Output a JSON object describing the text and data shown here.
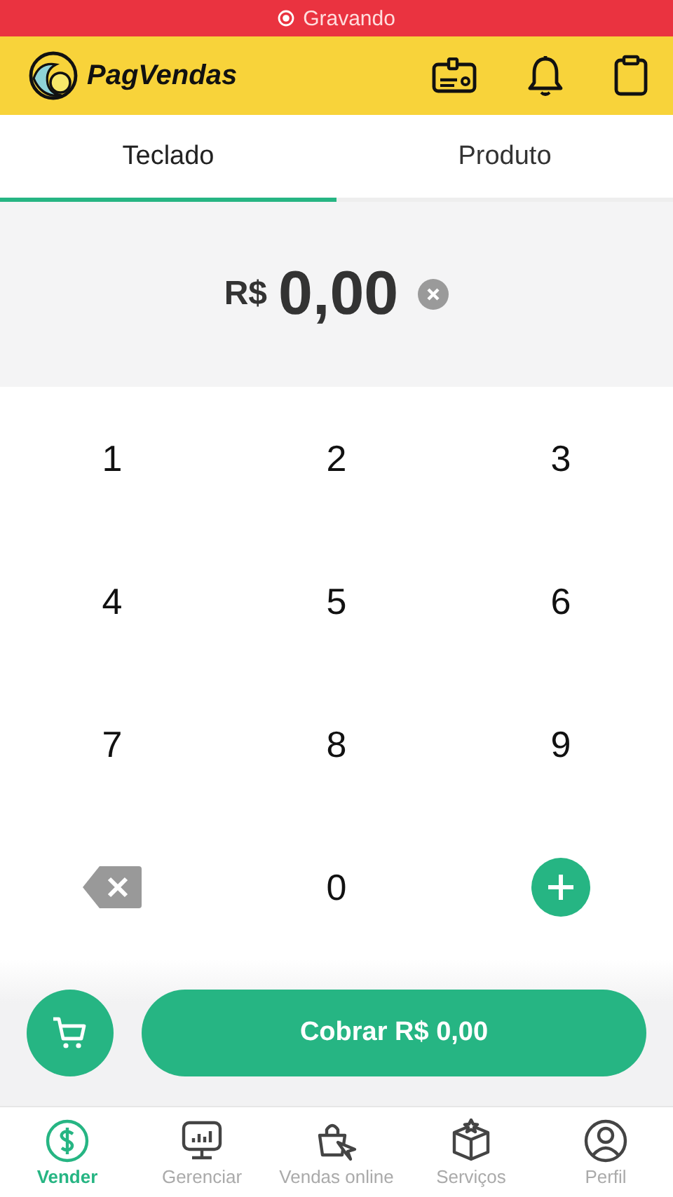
{
  "recording_bar": {
    "label": "Gravando"
  },
  "header": {
    "brand": "PagVendas"
  },
  "tabs": [
    {
      "label": "Teclado",
      "selected": true
    },
    {
      "label": "Produto",
      "selected": false
    }
  ],
  "amount": {
    "currency": "R$",
    "value": "0,00"
  },
  "keypad": [
    {
      "kind": "digit",
      "label": "1"
    },
    {
      "kind": "digit",
      "label": "2"
    },
    {
      "kind": "digit",
      "label": "3"
    },
    {
      "kind": "digit",
      "label": "4"
    },
    {
      "kind": "digit",
      "label": "5"
    },
    {
      "kind": "digit",
      "label": "6"
    },
    {
      "kind": "digit",
      "label": "7"
    },
    {
      "kind": "digit",
      "label": "8"
    },
    {
      "kind": "digit",
      "label": "9"
    },
    {
      "kind": "backspace"
    },
    {
      "kind": "digit",
      "label": "0"
    },
    {
      "kind": "plus"
    }
  ],
  "charge_button": {
    "label": "Cobrar R$ 0,00"
  },
  "bottom_nav": [
    {
      "label": "Vender",
      "selected": true
    },
    {
      "label": "Gerenciar",
      "selected": false
    },
    {
      "label": "Vendas online",
      "selected": false
    },
    {
      "label": "Serviços",
      "selected": false
    },
    {
      "label": "Perfil",
      "selected": false
    }
  ]
}
